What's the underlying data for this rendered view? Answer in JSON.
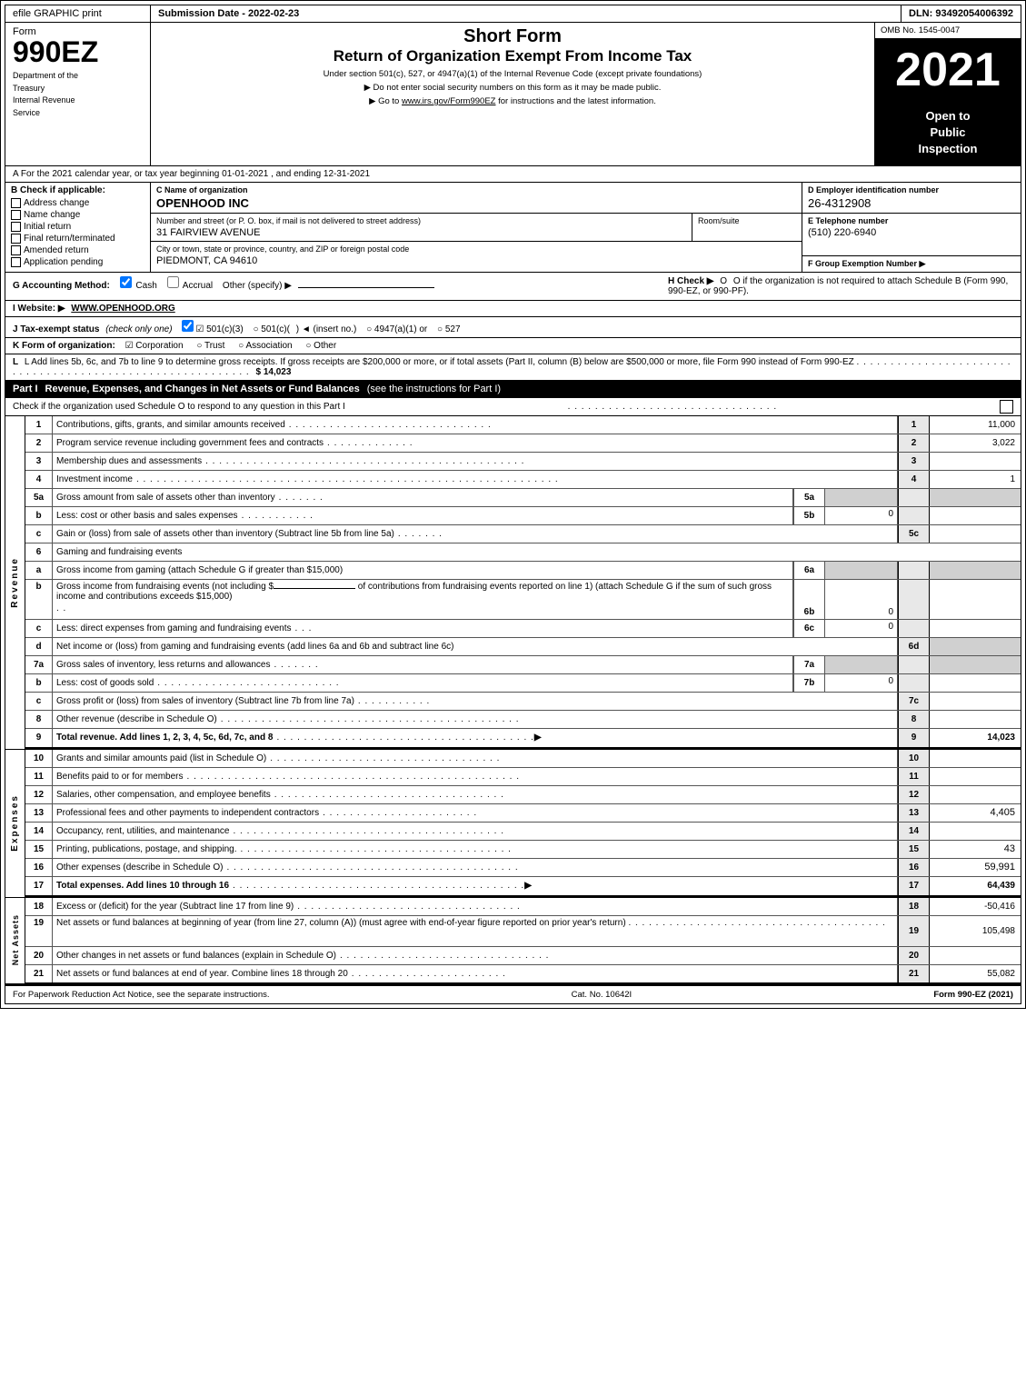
{
  "header": {
    "efile_label": "efile GRAPHIC print",
    "submission_label": "Submission Date - 2022-02-23",
    "dln_label": "DLN: 93492054006392"
  },
  "form_title": {
    "form_label": "Form",
    "form_number": "990EZ",
    "dept_line1": "Department of the",
    "dept_line2": "Treasury",
    "dept_line3": "Internal Revenue",
    "dept_line4": "Service",
    "short_form": "Short Form",
    "return_title": "Return of Organization Exempt From Income Tax",
    "under_section": "Under section 501(c), 527, or 4947(a)(1) of the Internal Revenue Code (except private foundations)",
    "do_not_enter": "▶ Do not enter social security numbers on this form as it may be made public.",
    "goto_irs": "▶ Go to",
    "goto_link": "www.irs.gov/Form990EZ",
    "goto_rest": "for instructions and the latest information.",
    "omb_label": "OMB No. 1545-0047",
    "year": "2021",
    "open_to": "Open to",
    "public": "Public",
    "inspection": "Inspection"
  },
  "section_a": {
    "label": "A For the 2021 calendar year, or tax year beginning 01-01-2021 , and ending 12-31-2021"
  },
  "section_b": {
    "label": "B Check if applicable:",
    "c_label": "C Name of organization",
    "org_name": "OPENHOOD INC",
    "d_label": "D Employer identification number",
    "ein": "26-4312908",
    "items": [
      {
        "id": "address_change",
        "label": "Address change",
        "checked": false
      },
      {
        "id": "name_change",
        "label": "Name change",
        "checked": false
      },
      {
        "id": "initial_return",
        "label": "Initial return",
        "checked": false
      },
      {
        "id": "final_return",
        "label": "Final return/terminated",
        "checked": false
      },
      {
        "id": "amended_return",
        "label": "Amended return",
        "checked": false
      },
      {
        "id": "application_pending",
        "label": "Application pending",
        "checked": false
      }
    ],
    "street_label": "Number and street (or P. O. box, if mail is not delivered to street address)",
    "street_value": "31 FAIRVIEW AVENUE",
    "room_label": "Room/suite",
    "room_value": "",
    "phone_label": "E Telephone number",
    "phone_value": "(510) 220-6940",
    "city_label": "City or town, state or province, country, and ZIP or foreign postal code",
    "city_value": "PIEDMONT, CA  94610",
    "group_exempt_label": "F Group Exemption Number ▶"
  },
  "accounting": {
    "g_label": "G Accounting Method:",
    "cash_label": "Cash",
    "cash_checked": true,
    "accrual_label": "Accrual",
    "accrual_checked": false,
    "other_label": "Other (specify) ▶",
    "h_label": "H Check ▶",
    "h_text": "O if the organization is not required to attach Schedule B (Form 990, 990-EZ, or 990-PF)."
  },
  "website": {
    "i_label": "I Website: ▶",
    "url": "WWW.OPENHOOD.ORG"
  },
  "tax_exempt": {
    "j_label": "J Tax-exempt status",
    "j_note": "(check only one)",
    "options": [
      {
        "label": "501(c)(3)",
        "checked": true
      },
      {
        "label": "501(c)(",
        "checked": false
      },
      {
        "label": ") ◄ (insert no.)",
        "checked": false
      },
      {
        "label": "4947(a)(1) or",
        "checked": false
      },
      {
        "label": "527",
        "checked": false
      }
    ]
  },
  "form_org": {
    "k_label": "K Form of organization:",
    "options": [
      {
        "label": "Corporation",
        "checked": true
      },
      {
        "label": "Trust",
        "checked": false
      },
      {
        "label": "Association",
        "checked": false
      },
      {
        "label": "Other",
        "checked": false
      }
    ]
  },
  "add_lines": {
    "l_label": "L Add lines 5b, 6c, and 7b to line 9 to determine gross receipts. If gross receipts are $200,000 or more, or if total assets (Part II, column (B) below are $500,000 or more, file Form 990 instead of Form 990-EZ",
    "dots": ". . . . . . . . . . . . . . . . . . . . . . . . . . . . . . . . . . . . . . . . . . . . . . . . . . . . . . . . . . . .",
    "arrow": "▶",
    "value": "$ 14,023"
  },
  "part1": {
    "header": "Part I",
    "title": "Revenue, Expenses, and Changes in Net Assets or Fund Balances",
    "see_instructions": "(see the instructions for Part I)",
    "check_label": "Check if the organization used Schedule O to respond to any question in this Part I",
    "dots": ". . . . . . . . . . . . . . . . . . . . . . . . . . . . . . ."
  },
  "revenue_rows": [
    {
      "num": "1",
      "desc": "Contributions, gifts, grants, and similar amounts received",
      "dots": ". . . . . . . . . . . . . . . . . . . . . . . . . . . . .",
      "line_num": "1",
      "value": "11,000",
      "shaded": false
    },
    {
      "num": "2",
      "desc": "Program service revenue including government fees and contracts",
      "dots": ". . . . . . . . . . . . .",
      "line_num": "2",
      "value": "3,022",
      "shaded": false
    },
    {
      "num": "3",
      "desc": "Membership dues and assessments",
      "dots": ". . . . . . . . . . . . . . . . . . . . . . . . . . . . . . . . . . . . . . . . . . . . . . .",
      "line_num": "3",
      "value": "",
      "shaded": false
    },
    {
      "num": "4",
      "desc": "Investment income",
      "dots": ". . . . . . . . . . . . . . . . . . . . . . . . . . . . . . . . . . . . . . . . . . . . . . . . . . . . . . . . . . . . . .",
      "line_num": "4",
      "value": "1",
      "shaded": false
    }
  ],
  "row5a": {
    "num": "5a",
    "desc": "Gross amount from sale of assets other than inventory",
    "dots": ". . . . . . .",
    "sub_num": "5a",
    "mid_val": "",
    "shaded": true
  },
  "row5b": {
    "num": "b",
    "desc": "Less: cost or other basis and sales expenses",
    "dots": ". . . . . . . . . . .",
    "sub_num": "5b",
    "mid_val": "0",
    "shaded": true
  },
  "row5c": {
    "num": "c",
    "desc": "Gain or (loss) from sale of assets other than inventory (Subtract line 5b from line 5a)",
    "dots": ". . . . . . .",
    "line_num": "5c",
    "value": "",
    "shaded": false
  },
  "row6_header": {
    "num": "6",
    "desc": "Gaming and fundraising events"
  },
  "row6a": {
    "num": "a",
    "desc": "Gross income from gaming (attach Schedule G if greater than $15,000)",
    "sub_num": "6a",
    "mid_val": "",
    "shaded": true
  },
  "row6b_intro": "Gross income from fundraising events (not including $______________ of contributions from fundraising events reported on line 1) (attach Schedule G if the sum of such gross income and contributions exceeds $15,000)",
  "row6b": {
    "num": "b",
    "sub_num": "6b",
    "mid_val": "0"
  },
  "row6c": {
    "num": "c",
    "desc": "Less: direct expenses from gaming and fundraising events",
    "dots": ". . .",
    "sub_num": "6c",
    "mid_val": "0"
  },
  "row6d": {
    "num": "d",
    "desc": "Net income or (loss) from gaming and fundraising events (add lines 6a and 6b and subtract line 6c)",
    "line_num": "6d",
    "value": "",
    "shaded": false
  },
  "row7a": {
    "num": "7a",
    "desc": "Gross sales of inventory, less returns and allowances",
    "dots": ". . . . . . .",
    "sub_num": "7a",
    "mid_val": "",
    "shaded": true
  },
  "row7b": {
    "num": "b",
    "desc": "Less: cost of goods sold",
    "dots": ". . . . . . . . . . . . . . . . . . . . . . . . . . . .",
    "sub_num": "7b",
    "mid_val": "0"
  },
  "row7c": {
    "num": "c",
    "desc": "Gross profit or (loss) from sales of inventory (Subtract line 7b from line 7a)",
    "dots": ". . . . . . . . . . .",
    "line_num": "7c",
    "value": "",
    "shaded": false
  },
  "row8": {
    "num": "8",
    "desc": "Other revenue (describe in Schedule O)",
    "dots": ". . . . . . . . . . . . . . . . . . . . . . . . . . . . . . . . . . . . . . . . . . . .",
    "line_num": "8",
    "value": "",
    "shaded": false
  },
  "row9": {
    "num": "9",
    "desc": "Total revenue. Add lines 1, 2, 3, 4, 5c, 6d, 7c, and 8",
    "dots": ". . . . . . . . . . . . . . . . . . . . . . . . . . . . . . . . . . . . . .",
    "arrow": "▶",
    "line_num": "9",
    "value": "14,023",
    "bold": true
  },
  "expenses_rows": [
    {
      "num": "10",
      "desc": "Grants and similar amounts paid (list in Schedule O)",
      "dots": ". . . . . . . . . . . . . . . . . . . . . . . . . . . . . . . . . .",
      "line_num": "10",
      "value": "",
      "shaded": false
    },
    {
      "num": "11",
      "desc": "Benefits paid to or for members",
      "dots": ". . . . . . . . . . . . . . . . . . . . . . . . . . . . . . . . . . . . . . . . . . . . . . . . .",
      "line_num": "11",
      "value": "",
      "shaded": false
    },
    {
      "num": "12",
      "desc": "Salaries, other compensation, and employee benefits",
      "dots": ". . . . . . . . . . . . . . . . . . . . . . . . . . . . . . . . . .",
      "line_num": "12",
      "value": "",
      "shaded": false
    },
    {
      "num": "13",
      "desc": "Professional fees and other payments to independent contractors",
      "dots": ". . . . . . . . . . . . . . . . . . . . . . .",
      "line_num": "13",
      "value": "4,405",
      "shaded": false
    },
    {
      "num": "14",
      "desc": "Occupancy, rent, utilities, and maintenance",
      "dots": ". . . . . . . . . . . . . . . . . . . . . . . . . . . . . . . . . . . . . . . . .",
      "line_num": "14",
      "value": "",
      "shaded": false
    },
    {
      "num": "15",
      "desc": "Printing, publications, postage, and shipping.",
      "dots": ". . . . . . . . . . . . . . . . . . . . . . . . . . . . . . . . . . . . . . . .",
      "line_num": "15",
      "value": "43",
      "shaded": false
    },
    {
      "num": "16",
      "desc": "Other expenses (describe in Schedule O)",
      "dots": ". . . . . . . . . . . . . . . . . . . . . . . . . . . . . . . . . . . . . . . . . . .",
      "line_num": "16",
      "value": "59,991",
      "shaded": false
    },
    {
      "num": "17",
      "desc": "Total expenses. Add lines 10 through 16",
      "dots": ". . . . . . . . . . . . . . . . . . . . . . . . . . . . . . . . . . . . . . . . . . .",
      "arrow": "▶",
      "line_num": "17",
      "value": "64,439",
      "bold": true
    }
  ],
  "net_assets_rows": [
    {
      "num": "18",
      "desc": "Excess or (deficit) for the year (Subtract line 17 from line 9)",
      "dots": ". . . . . . . . . . . . . . . . . . . . . . . . . . . . . . . . .",
      "line_num": "18",
      "value": "-50,416",
      "shaded": false
    },
    {
      "num": "19",
      "desc": "Net assets or fund balances at beginning of year (from line 27, column (A)) (must agree with end-of-year figure reported on prior year's return)",
      "dots": ". . . . . . . . . . . . . . . . . . . . . . . . . . . . . . . . . . . . . . .",
      "line_num": "19",
      "value": "105,498",
      "shaded": false
    },
    {
      "num": "20",
      "desc": "Other changes in net assets or fund balances (explain in Schedule O)",
      "dots": ". . . . . . . . . . . . . . . . . . . . . . . . . . . . . . .",
      "line_num": "20",
      "value": "",
      "shaded": false
    },
    {
      "num": "21",
      "desc": "Net assets or fund balances at end of year. Combine lines 18 through 20",
      "dots": ". . . . . . . . . . . . . . . . . . . . . . . .",
      "line_num": "21",
      "value": "55,082",
      "shaded": false
    }
  ],
  "footer": {
    "paperwork_label": "For Paperwork Reduction Act Notice, see the separate instructions.",
    "cat_no": "Cat. No. 10642I",
    "form_label": "Form 990-EZ (2021)"
  }
}
